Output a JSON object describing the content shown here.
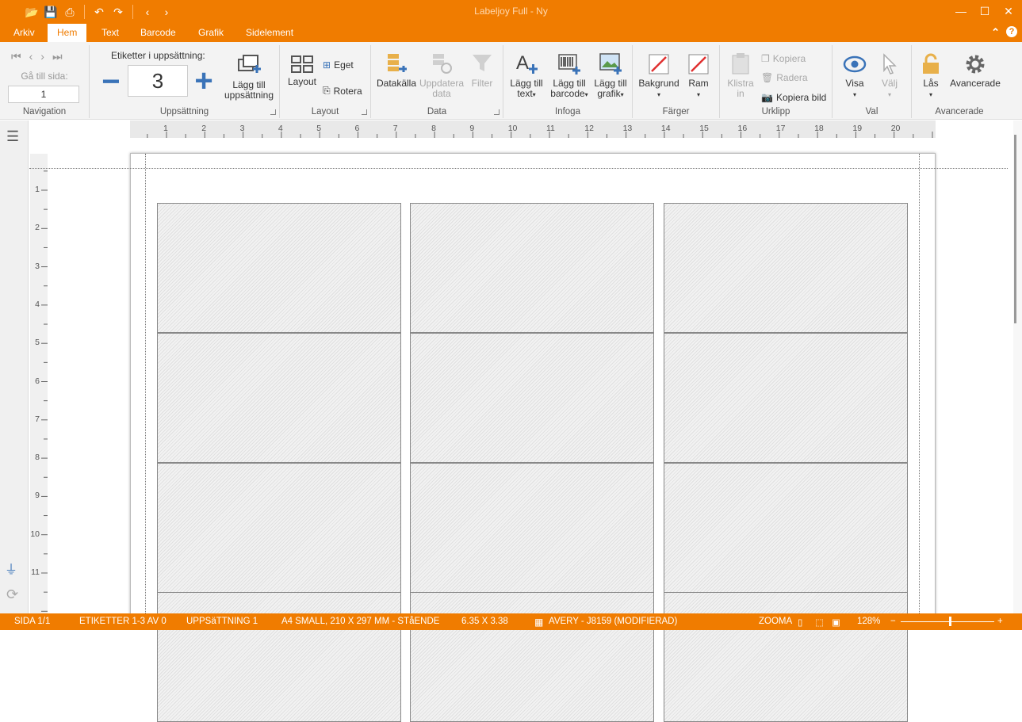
{
  "window": {
    "title": "Labeljoy Full - Ny"
  },
  "tabs": [
    "Arkiv",
    "Hem",
    "Text",
    "Barcode",
    "Grafik",
    "Sidelement"
  ],
  "active_tab": "Hem",
  "navigation": {
    "goto_label": "Gå till sida:",
    "page_value": "1",
    "group": "Navigation"
  },
  "uppsattning": {
    "title": "Etiketter i uppsättning:",
    "count": "3",
    "add_line1": "Lägg till",
    "add_line2": "uppsättning",
    "group": "Uppsättning"
  },
  "layout": {
    "layout": "Layout",
    "eget": "Eget",
    "rotera": "Rotera",
    "group": "Layout"
  },
  "data": {
    "datakalla": "Datakälla",
    "uppdatera1": "Uppdatera",
    "uppdatera2": "data",
    "filter": "Filter",
    "group": "Data"
  },
  "infoga": {
    "text1": "Lägg till",
    "text2": "text",
    "barcode1": "Lägg till",
    "barcode2": "barcode",
    "grafik1": "Lägg till",
    "grafik2": "grafik",
    "group": "Infoga"
  },
  "farger": {
    "bakgrund": "Bakgrund",
    "ram": "Ram",
    "group": "Färger"
  },
  "urklipp": {
    "klistra1": "Klistra",
    "klistra2": "in",
    "kopiera": "Kopiera",
    "radera": "Radera",
    "kopiera_bild": "Kopiera bild",
    "group": "Urklipp"
  },
  "val": {
    "visa": "Visa",
    "valj": "Välj",
    "group": "Val"
  },
  "avancerade": {
    "las": "Lås",
    "avancerade": "Avancerade",
    "group": "Avancerade"
  },
  "hruler": [
    "1",
    "2",
    "3",
    "4",
    "5",
    "6",
    "7",
    "8",
    "9",
    "10",
    "11",
    "12",
    "13",
    "14",
    "15",
    "16",
    "17",
    "18",
    "19",
    "20"
  ],
  "vruler": [
    "1",
    "2",
    "3",
    "4",
    "5",
    "6",
    "7",
    "8",
    "9",
    "10",
    "11"
  ],
  "status": {
    "sida": "SIDA 1/1",
    "etiketter": "ETIKETTER 1-3 AV 0",
    "uppsattning": "UPPSäTTNING 1",
    "paper": "A4 SMALL, 210 X 297 MM - STåENDE",
    "size": "6.35 X 3.38",
    "template": "AVERY - J8159 (MODIFIERAD)",
    "zoom_label": "ZOOMA",
    "zoom_value": "128%"
  },
  "colors": {
    "accent": "#f07c00",
    "blue": "#3a73b8",
    "red": "#e03030"
  }
}
